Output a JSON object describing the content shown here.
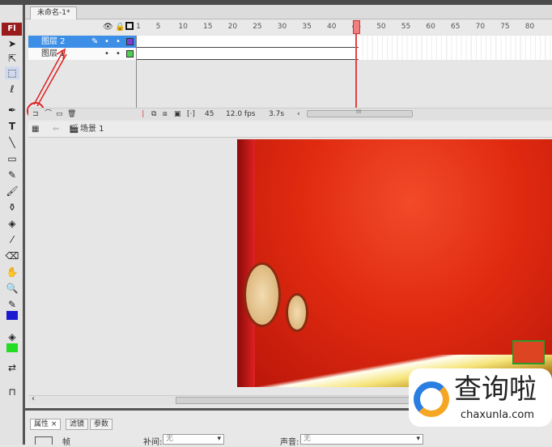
{
  "app": {
    "logo": "Fl",
    "document_tab": "未命名-1*"
  },
  "timeline": {
    "ruler_ticks": [
      "1",
      "5",
      "10",
      "15",
      "20",
      "25",
      "30",
      "35",
      "40",
      "45",
      "50",
      "55",
      "60",
      "65",
      "70",
      "75",
      "80"
    ],
    "layers": [
      {
        "name": "图层 2",
        "selected": true,
        "color": "#7a3fd0"
      },
      {
        "name": "图层 1",
        "selected": false,
        "color": "#4fd04f"
      }
    ],
    "current_frame": "45",
    "frame_rate": "12.0 fps",
    "elapsed": "3.7s",
    "scroll_thumb": "III"
  },
  "scene": {
    "label": "场景 1"
  },
  "properties": {
    "tabs": [
      "属性",
      "滤镜",
      "参数"
    ],
    "type_label": "帧",
    "tween_label": "补间:",
    "tween_value": "无",
    "sound_label": "声音:",
    "sound_value": "无"
  },
  "watermark": {
    "brand": "查询啦",
    "url": "chaxunla.com"
  },
  "colors": {
    "stroke": "#1a1ad0",
    "fill": "#22dd22",
    "selection": "#3d8ee6"
  }
}
